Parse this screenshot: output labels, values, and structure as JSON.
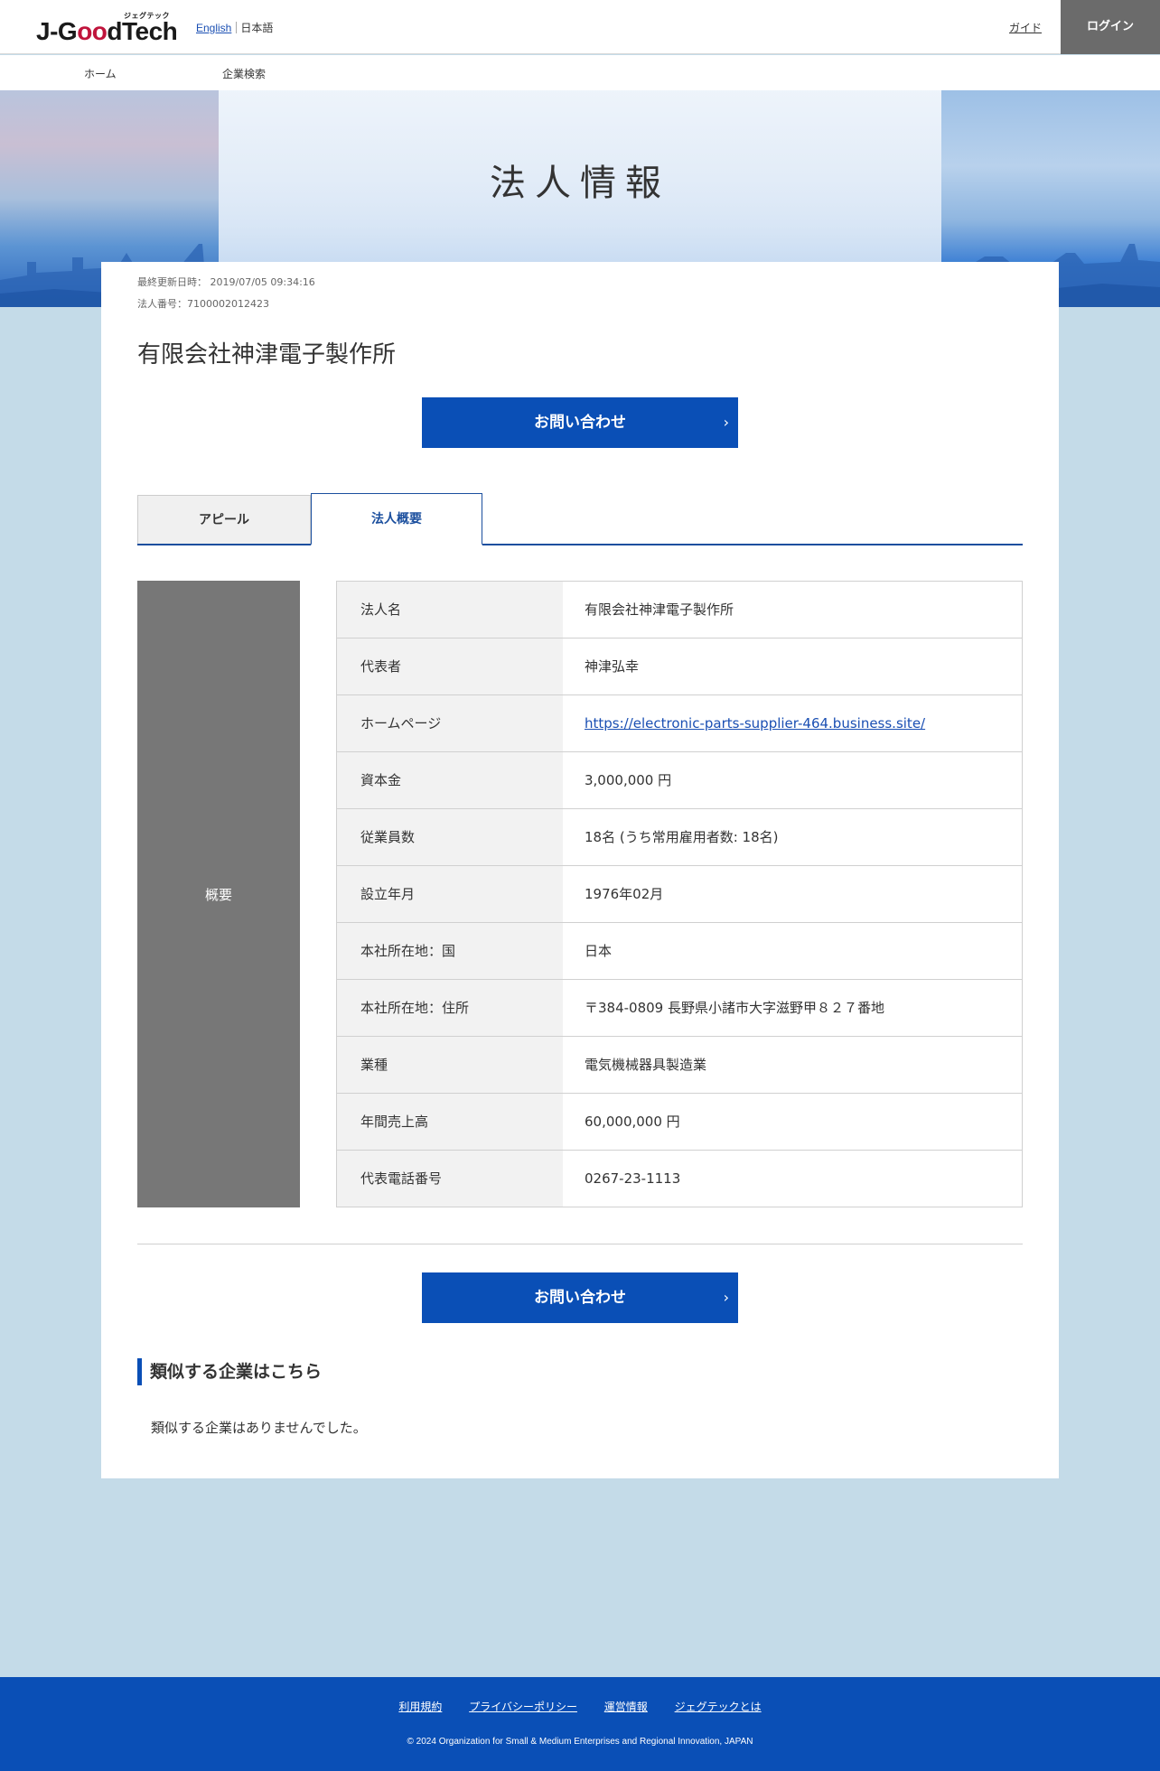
{
  "header": {
    "logo_kana": "ジェグテック",
    "logo_prefix": "J-G",
    "logo_oo": "oo",
    "logo_suffix": "dTech",
    "lang_english": "English",
    "lang_japanese": "日本語",
    "guide": "ガイド",
    "login": "ログイン"
  },
  "nav": {
    "home": "ホーム",
    "search": "企業検索"
  },
  "hero": {
    "title": "法人情報"
  },
  "company": {
    "last_updated": "最終更新日時： 2019/07/05 09:34:16",
    "corp_number": "法人番号：7100002012423",
    "name": "有限会社神津電子製作所"
  },
  "contact_button": "お問い合わせ",
  "tabs": {
    "appeal": "アピール",
    "overview": "法人概要"
  },
  "overview": {
    "side_label": "概要",
    "rows": [
      {
        "key": "法人名",
        "value": "有限会社神津電子製作所"
      },
      {
        "key": "代表者",
        "value": "神津弘幸"
      },
      {
        "key": "ホームページ",
        "value": "https://electronic-parts-supplier-464.business.site/"
      },
      {
        "key": "資本金",
        "value": "3,000,000 円"
      },
      {
        "key": "従業員数",
        "value": "18名 (うち常用雇用者数: 18名)"
      },
      {
        "key": "設立年月",
        "value": "1976年02月"
      },
      {
        "key": "本社所在地：国",
        "value": "日本"
      },
      {
        "key": "本社所在地：住所",
        "value": "〒384-0809 長野県小諸市大字滋野甲８２７番地"
      },
      {
        "key": "業種",
        "value": "電気機械器具製造業"
      },
      {
        "key": "年間売上高",
        "value": "60,000,000 円"
      },
      {
        "key": "代表電話番号",
        "value": "0267-23-1113"
      }
    ]
  },
  "similar": {
    "heading": "類似する企業はこちら",
    "empty": "類似する企業はありませんでした。"
  },
  "footer": {
    "links": [
      "利用規約",
      "プライバシーポリシー",
      "運営情報",
      "ジェグテックとは"
    ],
    "copyright": "© 2024 Organization for Small & Medium Enterprises and Regional Innovation, JAPAN"
  },
  "colors": {
    "primary": "#0a4fb6",
    "tab_active": "#1b4f9e",
    "login_bg": "#6b6b6b",
    "page_bg": "#c4dbe8",
    "side_label_bg": "#777777"
  }
}
